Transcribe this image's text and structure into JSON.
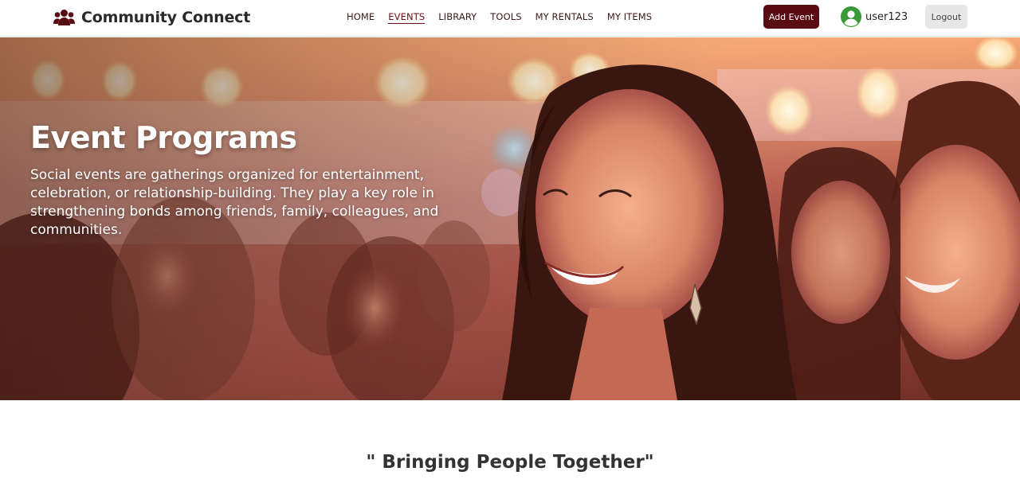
{
  "colors": {
    "brand_dark": "#5a0c14",
    "nav_text": "#3a1a1a",
    "avatar_green": "#3a9a3a",
    "logout_bg": "#e7e7e7"
  },
  "header": {
    "brand_icon": "users-icon",
    "brand_name": "Community Connect",
    "nav": [
      {
        "label": "HOME",
        "active": false
      },
      {
        "label": "EVENTS",
        "active": true
      },
      {
        "label": "LIBRARY",
        "active": false
      },
      {
        "label": "TOOLS",
        "active": false
      },
      {
        "label": "MY RENTALS",
        "active": false
      },
      {
        "label": "MY ITEMS",
        "active": false
      }
    ],
    "add_event_label": "Add Event",
    "user_icon": "user-circle-icon",
    "username": "user123",
    "logout_label": "Logout"
  },
  "hero": {
    "image": "hero-event-photo",
    "title": "Event Programs",
    "description": "Social events are gatherings organized for entertainment, celebration, or relationship-building. They play a key role in strengthening bonds among friends, family, colleagues, and communities."
  },
  "section": {
    "tagline": "\" Bringing People Together\""
  }
}
